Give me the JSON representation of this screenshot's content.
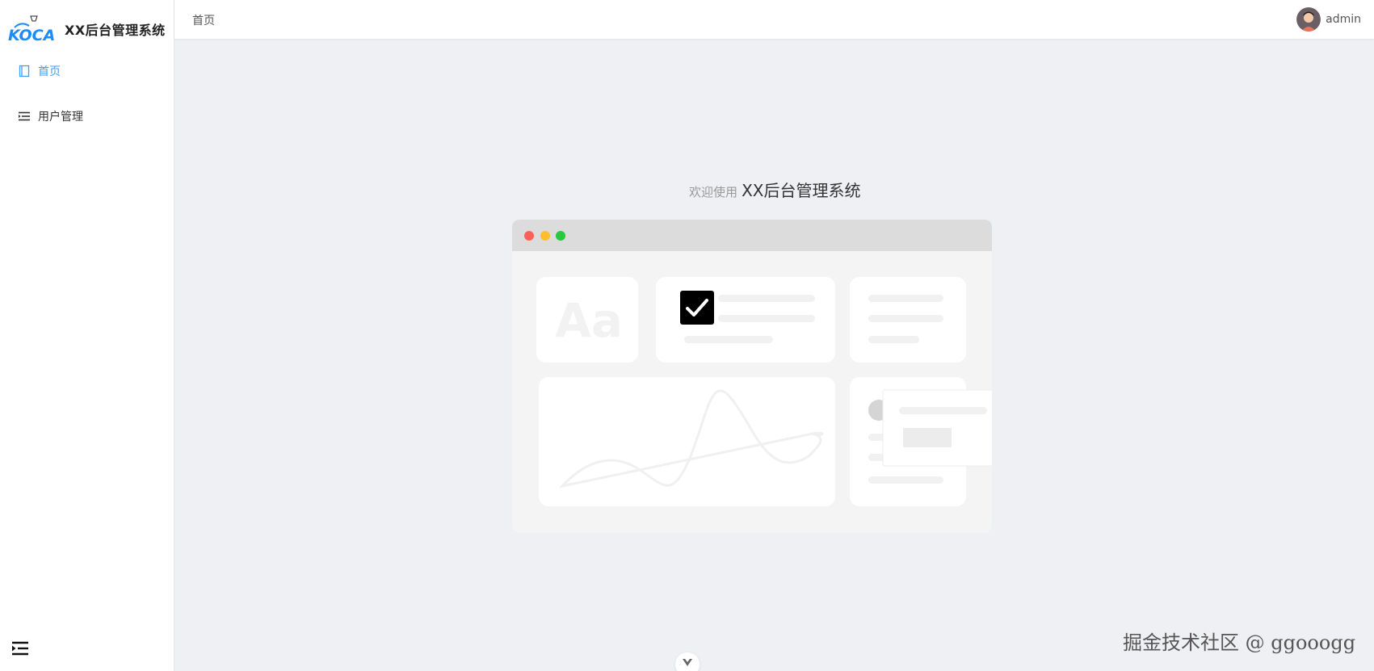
{
  "app": {
    "title": "XX后台管理系统",
    "logo_icon": "koca-logo-icon",
    "brand_color": "#1a8cff"
  },
  "sidebar": {
    "items": [
      {
        "label": "首页",
        "icon": "book-icon",
        "active": true
      },
      {
        "label": "用户管理",
        "icon": "menu-list-icon",
        "active": false
      }
    ],
    "collapse_icon": "menu-collapse-icon"
  },
  "header": {
    "breadcrumb": "首页",
    "username": "admin"
  },
  "main": {
    "welcome_prefix": "欢迎使用",
    "welcome_name": "XX后台管理系统",
    "illustration_text": "Aa"
  },
  "watermark": "掘金技术社区 @ ggooogg",
  "colors": {
    "active": "#409eff",
    "dot_red": "#ff5f57",
    "dot_yellow": "#ffbd2e",
    "dot_green": "#28c840"
  }
}
